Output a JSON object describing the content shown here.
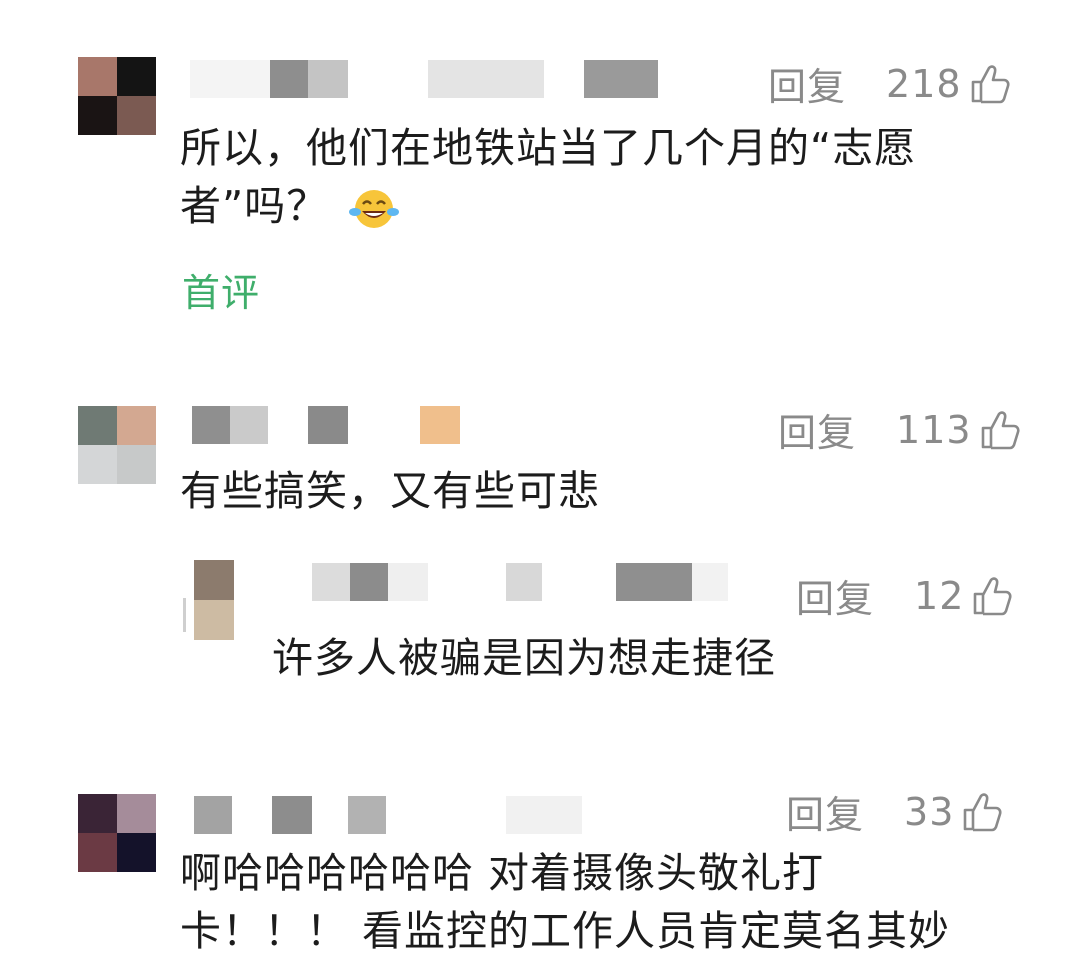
{
  "comments": [
    {
      "reply_label": "回复",
      "likes": "218",
      "text_line1": "所以，他们在地铁站当了几个月的“志愿",
      "text_line2": "者”吗？",
      "emoji": "laughing-tears-emoji",
      "tag": "首评"
    },
    {
      "reply_label": "回复",
      "likes": "113",
      "text_line1": "有些搞笑，又有些可悲"
    },
    {
      "reply_label": "回复",
      "likes": "12",
      "text_line1": "许多人被骗是因为想走捷径"
    },
    {
      "reply_label": "回复",
      "likes": "33",
      "text_line1": "啊哈哈哈哈哈哈 对着摄像头敬礼打",
      "text_line2": "卡！！！ 看监控的工作人员肯定莫名其妙"
    }
  ],
  "colors": {
    "meta_gray": "#8a8a8a",
    "tag_green": "#3fae6b",
    "text": "#1c1c1c"
  }
}
